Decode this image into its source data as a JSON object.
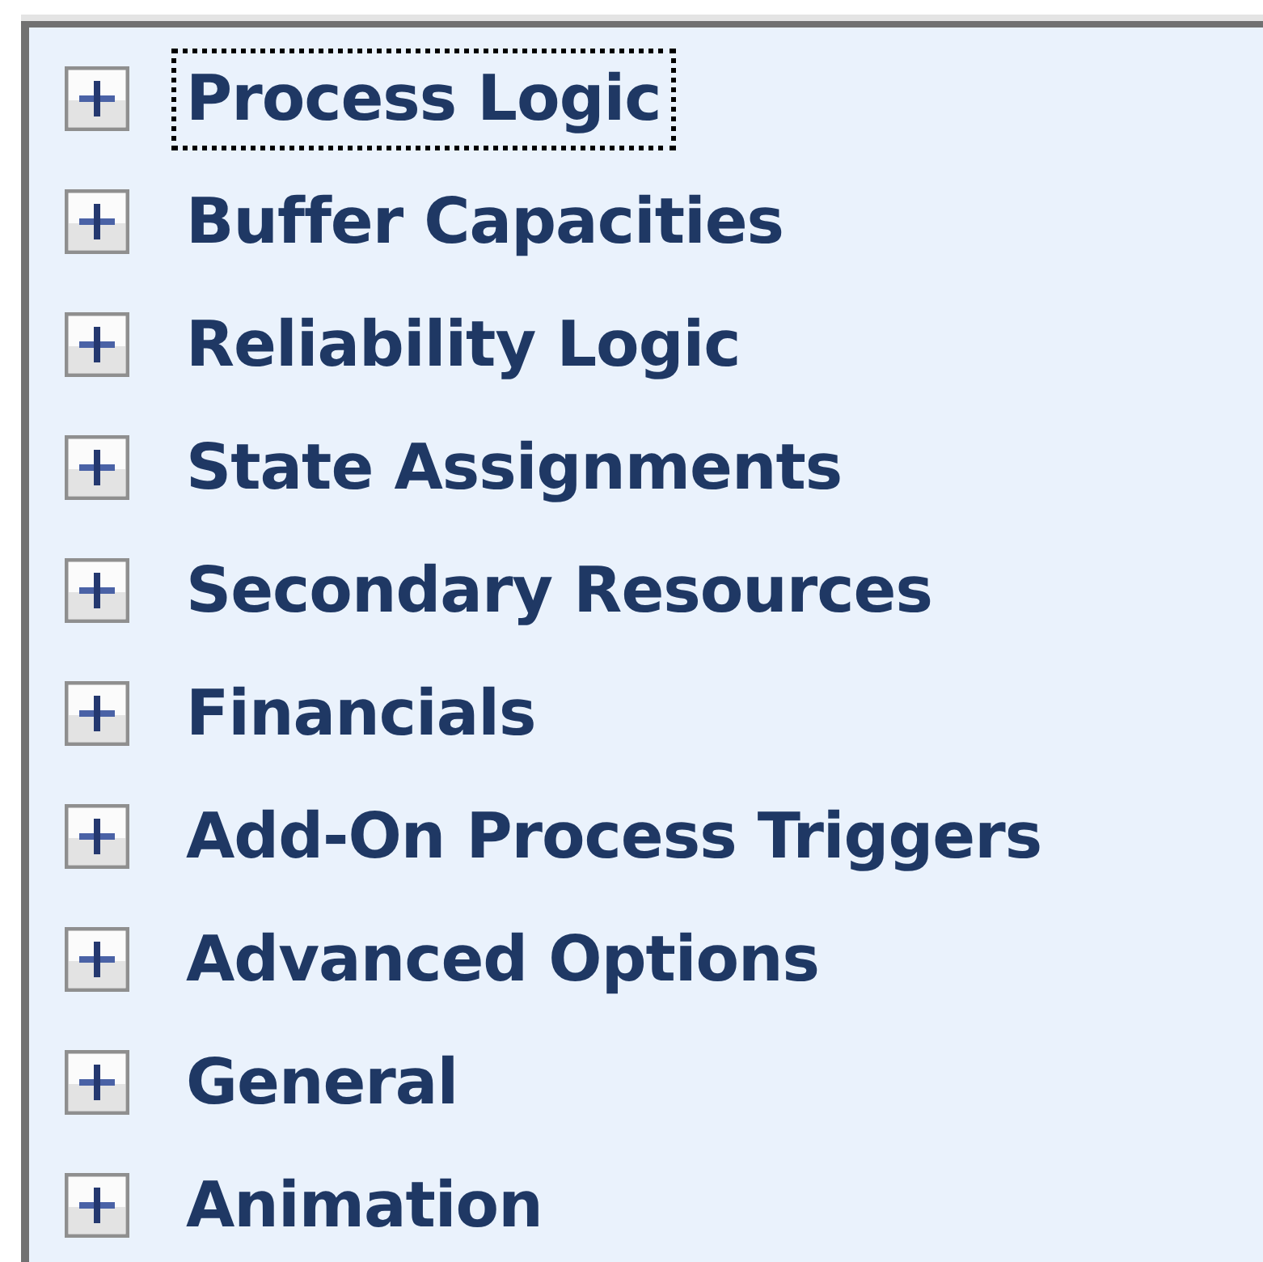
{
  "categories": [
    {
      "label": "Process Logic",
      "expanded": false,
      "selected": true
    },
    {
      "label": "Buffer Capacities",
      "expanded": false,
      "selected": false
    },
    {
      "label": "Reliability Logic",
      "expanded": false,
      "selected": false
    },
    {
      "label": "State Assignments",
      "expanded": false,
      "selected": false
    },
    {
      "label": "Secondary Resources",
      "expanded": false,
      "selected": false
    },
    {
      "label": "Financials",
      "expanded": false,
      "selected": false
    },
    {
      "label": "Add-On Process Triggers",
      "expanded": false,
      "selected": false
    },
    {
      "label": "Advanced Options",
      "expanded": false,
      "selected": false
    },
    {
      "label": "General",
      "expanded": false,
      "selected": false
    },
    {
      "label": "Animation",
      "expanded": false,
      "selected": false
    }
  ]
}
